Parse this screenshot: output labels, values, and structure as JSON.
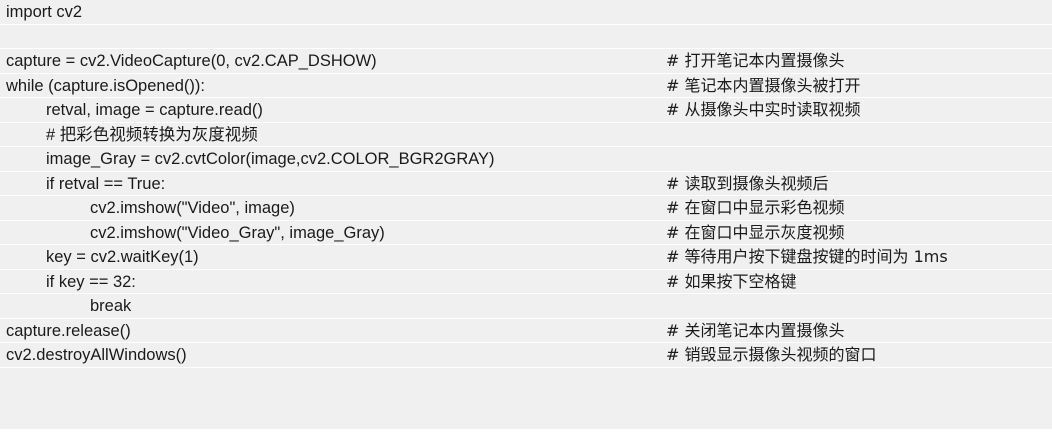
{
  "lines": [
    {
      "code": "import cv2",
      "comment": ""
    },
    {
      "code": "",
      "comment": ""
    },
    {
      "code": "capture = cv2.VideoCapture(0, cv2.CAP_DSHOW)",
      "comment": "# 打开笔记本内置摄像头"
    },
    {
      "code": "while (capture.isOpened()):",
      "comment": "# 笔记本内置摄像头被打开"
    },
    {
      "code": "retval, image = capture.read()",
      "comment": "# 从摄像头中实时读取视频"
    },
    {
      "code": "# 把彩色视频转换为灰度视频",
      "comment": ""
    },
    {
      "code": "image_Gray = cv2.cvtColor(image,cv2.COLOR_BGR2GRAY)",
      "comment": ""
    },
    {
      "code": "if retval == True:",
      "comment": "# 读取到摄像头视频后"
    },
    {
      "code": "cv2.imshow(\"Video\", image)",
      "comment": "# 在窗口中显示彩色视频"
    },
    {
      "code": "cv2.imshow(\"Video_Gray\", image_Gray)",
      "comment": "# 在窗口中显示灰度视频"
    },
    {
      "code": "key = cv2.waitKey(1)",
      "comment": "# 等待用户按下键盘按键的时间为 1ms"
    },
    {
      "code": "if key == 32:",
      "comment": "# 如果按下空格键"
    },
    {
      "code": "break",
      "comment": ""
    },
    {
      "code": "capture.release()",
      "comment": "# 关闭笔记本内置摄像头"
    },
    {
      "code": "cv2.destroyAllWindows()",
      "comment": "# 销毁显示摄像头视频的窗口"
    }
  ]
}
